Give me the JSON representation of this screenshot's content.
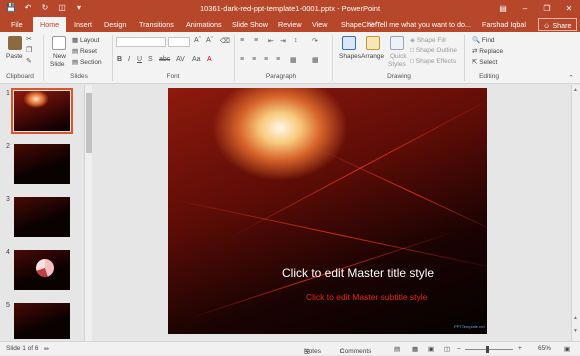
{
  "titlebar": {
    "document_title": "10361-dark-red-ppt-template1-0001.pptx - PowerPoint",
    "qat": [
      "save-icon",
      "undo-icon",
      "redo-icon",
      "start-slideshow-icon",
      "customize-icon"
    ],
    "window_controls": [
      "ribbon-display-icon",
      "minimize-icon",
      "restore-icon",
      "close-icon"
    ]
  },
  "tabs": [
    "File",
    "Home",
    "Insert",
    "Design",
    "Transitions",
    "Animations",
    "Slide Show",
    "Review",
    "View",
    "ShapeChef"
  ],
  "active_tab": "Home",
  "tell_me": "Tell me what you want to do...",
  "user": "Farshad Iqbal",
  "share": "Share",
  "ribbon": {
    "clipboard": {
      "label": "Clipboard",
      "paste": "Paste"
    },
    "slides": {
      "label": "Slides",
      "new_slide": "New",
      "new_slide_2": "Slide",
      "layout": "Layout",
      "reset": "Reset",
      "section": "Section"
    },
    "font": {
      "label": "Font"
    },
    "paragraph": {
      "label": "Paragraph"
    },
    "drawing": {
      "label": "Drawing",
      "shapes": "Shapes",
      "arrange": "Arrange",
      "quick_styles": "Quick",
      "quick_styles_2": "Styles",
      "shape_fill": "Shape Fill",
      "shape_outline": "Shape Outline",
      "shape_effects": "Shape Effects"
    },
    "editing": {
      "label": "Editing",
      "find": "Find",
      "replace": "Replace",
      "select": "Select"
    }
  },
  "thumbnails": [
    {
      "number": "1",
      "selected": true
    },
    {
      "number": "2",
      "selected": false
    },
    {
      "number": "3",
      "selected": false
    },
    {
      "number": "4",
      "selected": false
    },
    {
      "number": "5",
      "selected": false
    }
  ],
  "slide": {
    "title": "Click to edit Master title style",
    "subtitle": "Click to edit Master subtitle style",
    "logo_text": "PPTTemplate.net"
  },
  "status": {
    "slide_info": "Slide 1 of 6",
    "notes": "Notes",
    "comments": "Comments",
    "zoom": "65%"
  },
  "colors": {
    "accent": "#b7472a",
    "subtitle": "#e02a1a"
  }
}
